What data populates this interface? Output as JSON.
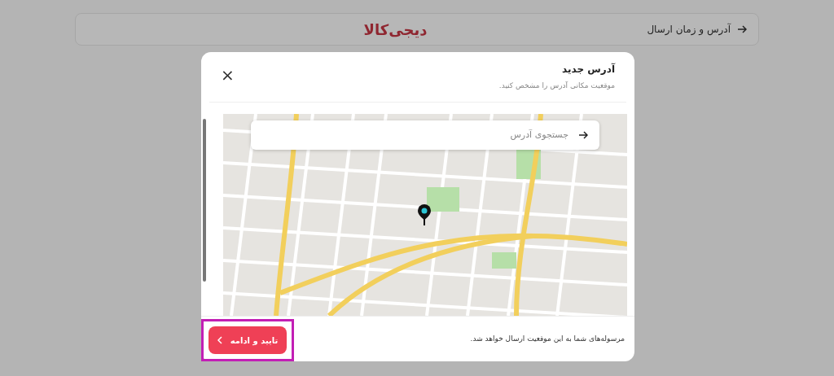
{
  "header": {
    "back_label": "آدرس و زمان ارسال",
    "logo": "دیجی‌کالا"
  },
  "modal": {
    "title": "آدرس جدید",
    "subtitle": "موقعیت مکانی آدرس را مشخص کنید.",
    "close": "×",
    "map": {
      "search": {
        "placeholder": "جستجوی آدرس"
      }
    },
    "footer_note": "مرسوله‌های شما به این موقعیت ارسال خواهد شد.",
    "confirm_button": {
      "label": "تایید و ادامه",
      "highlighted": true
    }
  }
}
